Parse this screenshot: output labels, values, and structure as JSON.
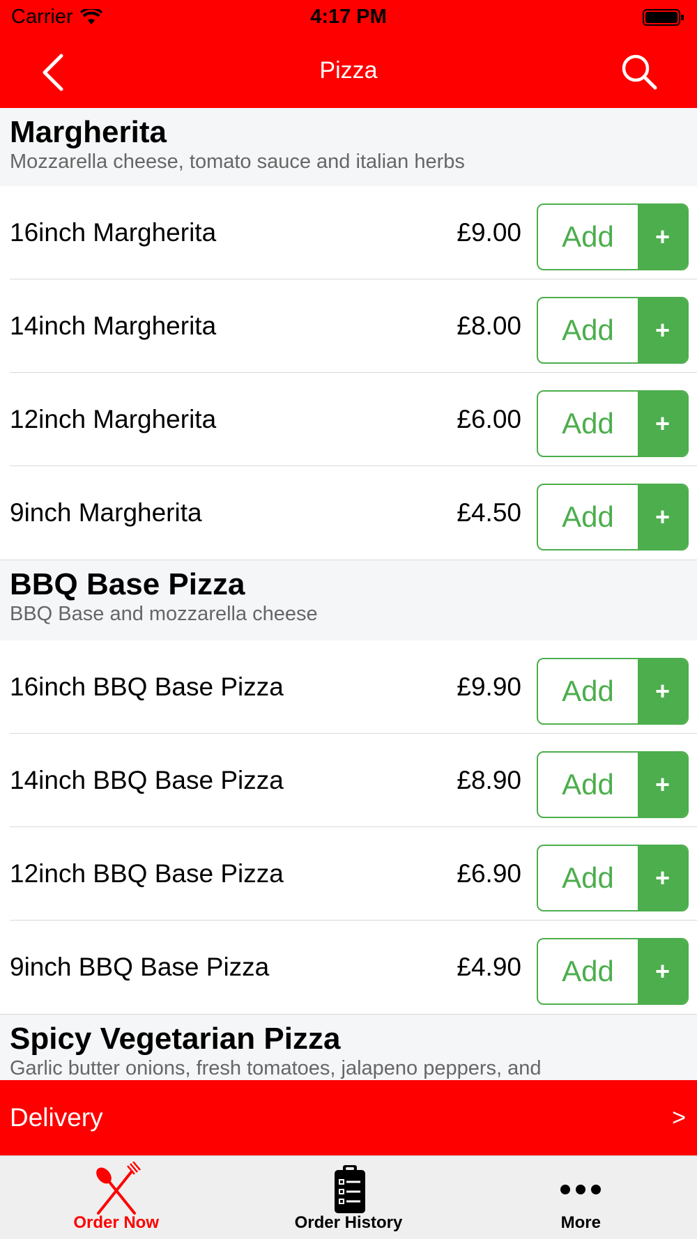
{
  "status_bar": {
    "carrier": "Carrier",
    "time": "4:17 PM"
  },
  "navbar": {
    "title": "Pizza"
  },
  "sections": [
    {
      "title": "Margherita",
      "description": "Mozzarella cheese, tomato sauce and italian herbs",
      "items": [
        {
          "name": "16inch Margherita",
          "price": "£9.00"
        },
        {
          "name": "14inch Margherita",
          "price": "£8.00"
        },
        {
          "name": "12inch Margherita",
          "price": "£6.00"
        },
        {
          "name": "9inch Margherita",
          "price": "£4.50"
        }
      ]
    },
    {
      "title": "BBQ Base Pizza",
      "description": "BBQ Base and mozzarella cheese",
      "items": [
        {
          "name": "16inch BBQ Base Pizza",
          "price": "£9.90"
        },
        {
          "name": "14inch BBQ Base Pizza",
          "price": "£8.90"
        },
        {
          "name": "12inch BBQ Base Pizza",
          "price": "£6.90"
        },
        {
          "name": "9inch BBQ Base Pizza",
          "price": "£4.90"
        }
      ]
    },
    {
      "title": "Spicy Vegetarian Pizza",
      "description": "Garlic butter onions, fresh tomatoes, jalapeno peppers, and",
      "items": []
    }
  ],
  "buttons": {
    "add_label": "Add",
    "plus_label": "+"
  },
  "delivery": {
    "label": "Delivery",
    "arrow": ">"
  },
  "tabs": [
    {
      "label": "Order Now",
      "icon": "fork-knife-icon",
      "active": true
    },
    {
      "label": "Order History",
      "icon": "clipboard-icon",
      "active": false
    },
    {
      "label": "More",
      "icon": "more-dots-icon",
      "active": false
    }
  ],
  "colors": {
    "brand_red": "#ff0000",
    "add_green": "#4cae4c",
    "section_bg": "#f5f6f8"
  }
}
